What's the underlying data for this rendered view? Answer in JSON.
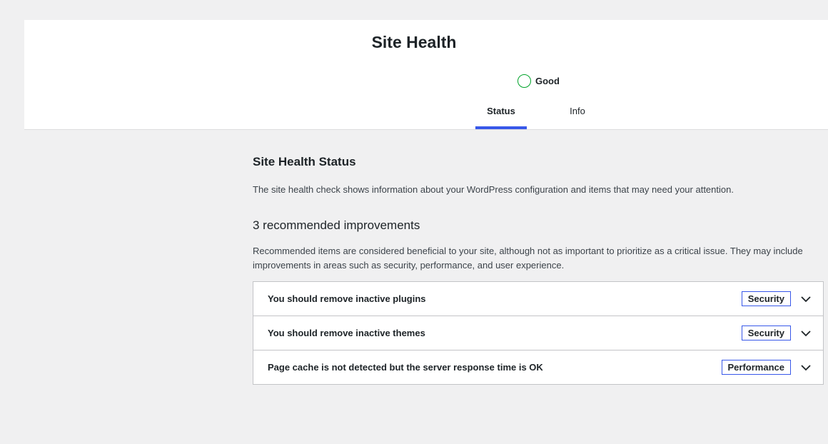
{
  "header": {
    "title": "Site Health",
    "status": {
      "label": "Good",
      "color": "#00a32a"
    },
    "tabs": [
      {
        "label": "Status",
        "active": true
      },
      {
        "label": "Info",
        "active": false
      }
    ],
    "accent_color": "#3858e9"
  },
  "main": {
    "section_title": "Site Health Status",
    "section_description": "The site health check shows information about your WordPress configuration and items that may need your attention.",
    "improvements_title": "3 recommended improvements",
    "improvements_description": "Recommended items are considered beneficial to your site, although not as important to prioritize as a critical issue. They may include improvements in areas such as security, performance, and user experience.",
    "issues": [
      {
        "title": "You should remove inactive plugins",
        "badge": "Security",
        "icon": "chevron-down-icon"
      },
      {
        "title": "You should remove inactive themes",
        "badge": "Security",
        "icon": "chevron-down-icon"
      },
      {
        "title": "Page cache is not detected but the server response time is OK",
        "badge": "Performance",
        "icon": "chevron-down-icon"
      }
    ]
  }
}
